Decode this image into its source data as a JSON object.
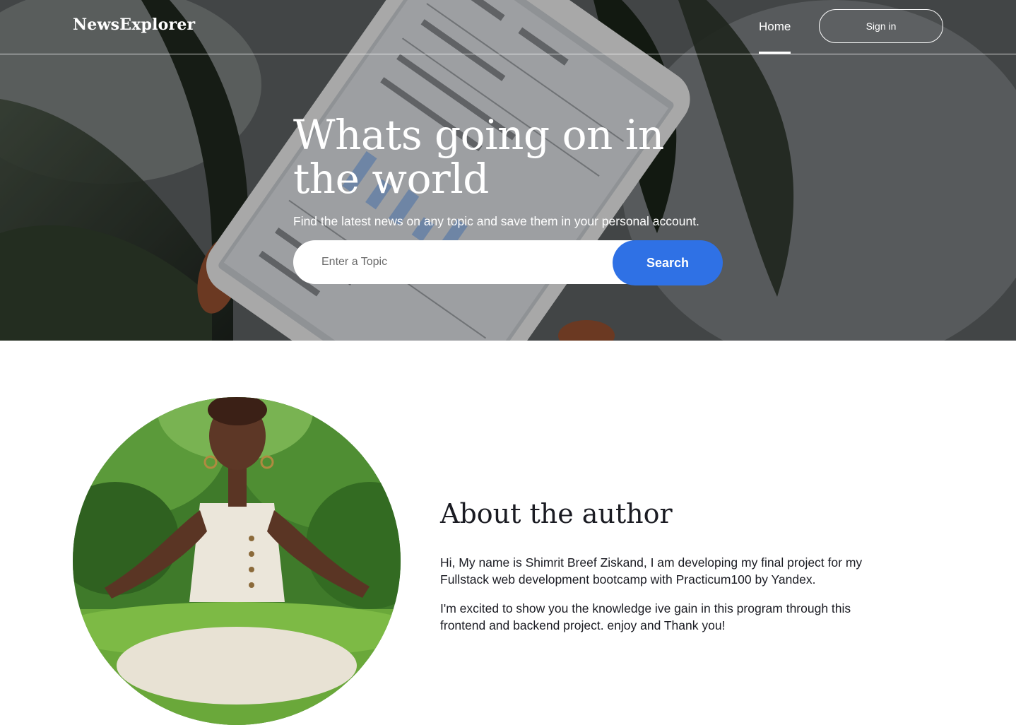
{
  "header": {
    "logo": "NewsExplorer",
    "nav_home": "Home",
    "signin_label": "Sign in"
  },
  "hero": {
    "title": "Whats going on in the world",
    "subtitle": "Find the latest news on any topic and save them in your personal account.",
    "search_placeholder": "Enter a Topic",
    "search_button": "Search"
  },
  "about": {
    "title": "About the author",
    "paragraphs": [
      "Hi, My name is Shimrit Breef Ziskand, I am developing my final project for my Fullstack web development bootcamp with Practicum100 by Yandex.",
      "I'm excited to show you the knowledge ive gain in this program through this frontend and backend project. enjoy and Thank you!"
    ]
  },
  "colors": {
    "accent": "#2f71e5",
    "text_dark": "#1a1b22",
    "white": "#ffffff"
  }
}
